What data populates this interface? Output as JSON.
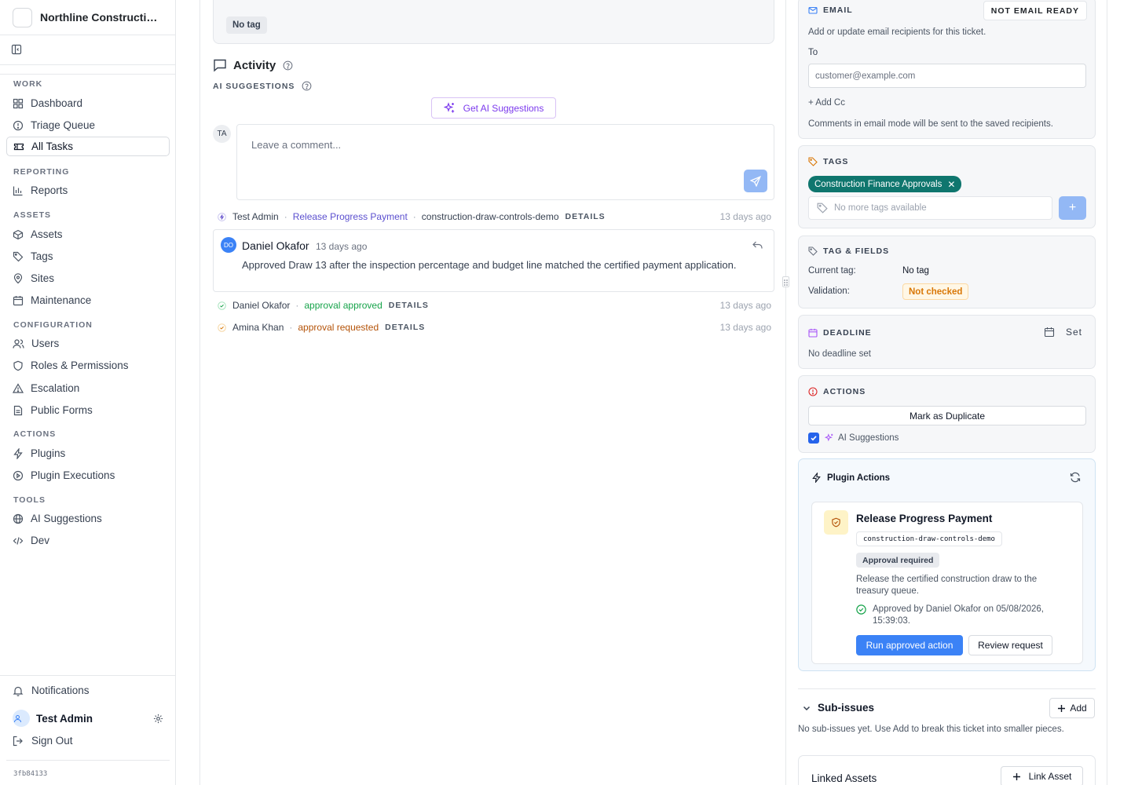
{
  "sidebar": {
    "org_name": "Northline Construction",
    "sections": {
      "work": "WORK",
      "reporting": "REPORTING",
      "assets": "ASSETS",
      "configuration": "CONFIGURATION",
      "actions": "ACTIONS",
      "tools": "TOOLS"
    },
    "items": {
      "dashboard": "Dashboard",
      "triage": "Triage Queue",
      "all_tasks": "All Tasks",
      "reports": "Reports",
      "assets": "Assets",
      "tags": "Tags",
      "sites": "Sites",
      "maintenance": "Maintenance",
      "users": "Users",
      "roles": "Roles & Permissions",
      "escalation": "Escalation",
      "public_forms": "Public Forms",
      "plugins": "Plugins",
      "plugin_executions": "Plugin Executions",
      "ai_suggestions": "AI Suggestions",
      "dev": "Dev"
    },
    "active_item": "All Tasks",
    "notifications": "Notifications",
    "user_name": "Test Admin",
    "sign_out": "Sign Out",
    "build": "3fb84133"
  },
  "main": {
    "tag_chip": "No tag",
    "activity_title": "Activity",
    "ai_suggestions_label": "AI SUGGESTIONS",
    "get_ai_button": "Get AI Suggestions",
    "commenter_initials": "TA",
    "comment_placeholder": "Leave a comment...",
    "events": [
      {
        "actor": "Test Admin",
        "action": "Release Progress Payment",
        "detail": "construction-draw-controls-demo",
        "details_label": "DETAILS",
        "time": "13 days ago"
      },
      {
        "actor": "Daniel Okafor",
        "action": "approval approved",
        "details_label": "DETAILS",
        "time": "13 days ago"
      },
      {
        "actor": "Amina Khan",
        "action": "approval requested",
        "details_label": "DETAILS",
        "time": "13 days ago"
      }
    ],
    "comment": {
      "initials": "DO",
      "author": "Daniel Okafor",
      "time": "13 days ago",
      "body": "Approved Draw 13 after the inspection percentage and budget line matched the certified payment application."
    }
  },
  "right": {
    "email": {
      "label": "EMAIL",
      "status": "NOT EMAIL READY",
      "help": "Add or update email recipients for this ticket.",
      "to_label": "To",
      "to_placeholder": "customer@example.com",
      "add_cc": "+ Add Cc",
      "note": "Comments in email mode will be sent to the saved recipients."
    },
    "tags": {
      "label": "TAGS",
      "tag": "Construction Finance Approvals",
      "input_placeholder": "No more tags available",
      "add_symbol": "+"
    },
    "tag_fields": {
      "label": "TAG & FIELDS",
      "current_tag_label": "Current tag:",
      "current_tag_value": "No tag",
      "validation_label": "Validation:",
      "validation_value": "Not checked"
    },
    "deadline": {
      "label": "DEADLINE",
      "set_label": "Set",
      "empty": "No deadline set"
    },
    "actions": {
      "label": "ACTIONS",
      "duplicate_button": "Mark as Duplicate",
      "ai_checkbox_label": "AI Suggestions"
    },
    "plugin_actions": {
      "title": "Plugin Actions",
      "action_title": "Release Progress Payment",
      "code": "construction-draw-controls-demo",
      "requirement": "Approval required",
      "description": "Release the certified construction draw to the treasury queue.",
      "approval_note": "Approved by Daniel Okafor on 05/08/2026, 15:39:03.",
      "run_button": "Run approved action",
      "review_button": "Review request"
    },
    "sub_issues": {
      "title": "Sub-issues",
      "add_button": "Add",
      "empty": "No sub-issues yet. Use Add to break this ticket into smaller pieces."
    },
    "linked_assets": {
      "title": "Linked Assets",
      "link_button": "Link Asset"
    }
  },
  "colors": {
    "accent_blue": "#3b82f6",
    "ai_purple": "#7c3aed",
    "teal_tag": "#0f766e",
    "approved_green": "#16a34a",
    "requested_amber": "#b45309"
  }
}
